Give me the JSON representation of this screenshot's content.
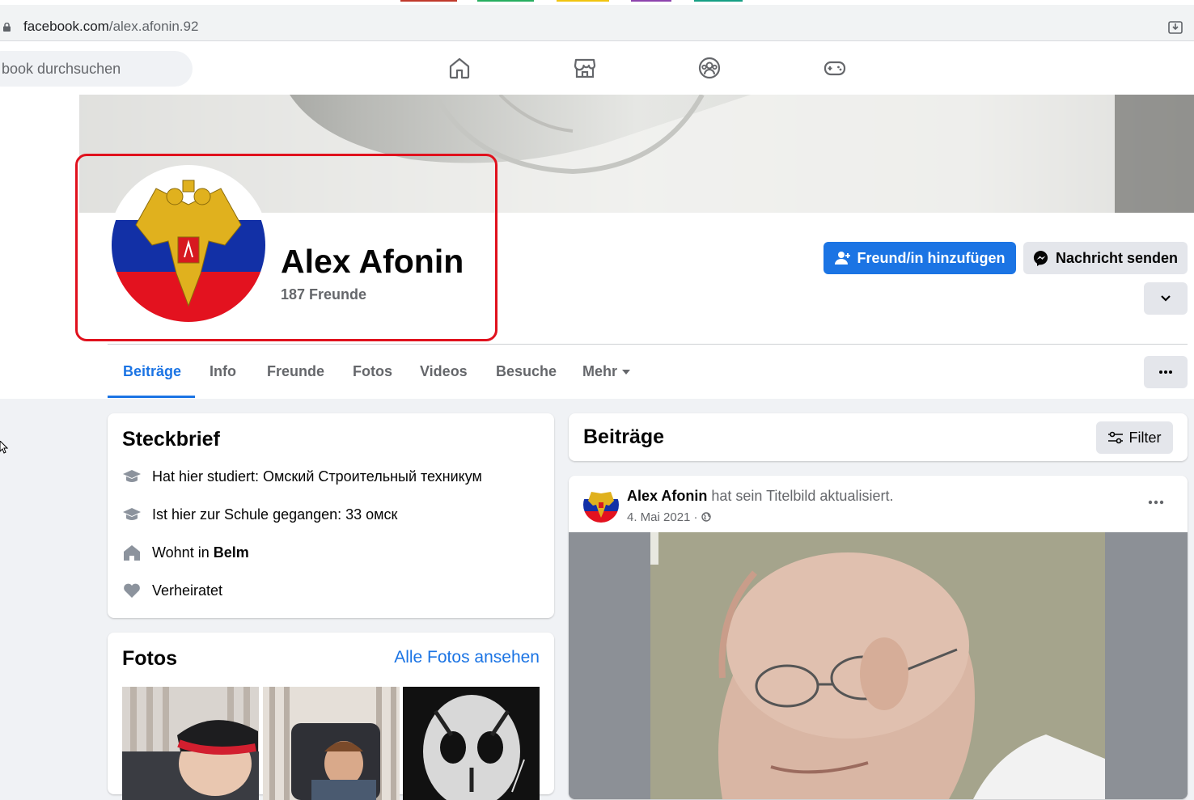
{
  "browser": {
    "url_domain": "facebook.com",
    "url_path": "/alex.afonin.92",
    "install_icon": "install-app-icon"
  },
  "nav": {
    "search_placeholder": "book durchsuchen",
    "icons": [
      "home-icon",
      "marketplace-icon",
      "groups-icon",
      "gaming-icon"
    ]
  },
  "profile": {
    "name": "Alex Afonin",
    "friends_count": "187 Freunde",
    "add_friend_label": "Freund/in hinzufügen",
    "message_label": "Nachricht senden"
  },
  "tabs": [
    "Beiträge",
    "Info",
    "Freunde",
    "Fotos",
    "Videos",
    "Besuche",
    "Mehr"
  ],
  "intro": {
    "title": "Steckbrief",
    "studied": "Hat hier studiert: Омский Строительный техникум",
    "school": "Ist hier zur Schule gegangen: 33 омск",
    "lives_prefix": "Wohnt in ",
    "lives_city": "Belm",
    "relationship": "Verheiratet"
  },
  "photos": {
    "title": "Fotos",
    "see_all": "Alle Fotos ansehen"
  },
  "posts": {
    "title": "Beiträge",
    "filter_label": "Filter",
    "post": {
      "author": "Alex Afonin",
      "action": " hat sein Titelbild aktualisiert.",
      "date": "4. Mai 2021 · "
    }
  },
  "colors": {
    "accent": "#1b74e4",
    "highlight_box": "#e0111d",
    "page_bg": "#f0f2f5"
  }
}
